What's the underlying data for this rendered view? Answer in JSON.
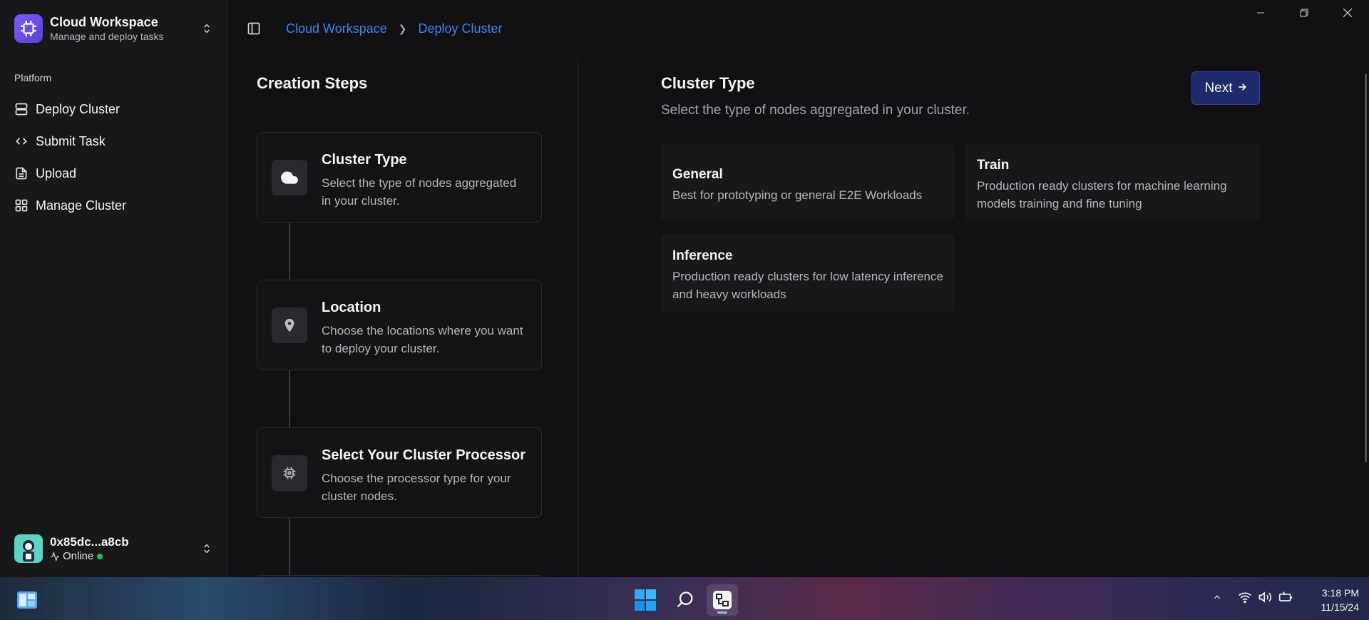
{
  "sidebar": {
    "brand_title": "Cloud Workspace",
    "brand_subtitle": "Manage and deploy tasks",
    "section_label": "Platform",
    "items": [
      {
        "label": "Deploy Cluster",
        "icon": "server-icon"
      },
      {
        "label": "Submit Task",
        "icon": "code-icon"
      },
      {
        "label": "Upload",
        "icon": "file-icon"
      },
      {
        "label": "Manage Cluster",
        "icon": "grid-icon"
      }
    ],
    "user": {
      "name": "0x85dc...a8cb",
      "status": "Online"
    }
  },
  "breadcrumb": {
    "root": "Cloud Workspace",
    "current": "Deploy Cluster"
  },
  "steps": {
    "title": "Creation Steps",
    "items": [
      {
        "title": "Cluster Type",
        "description": "Select the type of nodes aggregated in your cluster.",
        "icon": "cloud-icon"
      },
      {
        "title": "Location",
        "description": "Choose the locations where you want to deploy your cluster.",
        "icon": "map-pin-icon"
      },
      {
        "title": "Select Your Cluster Processor",
        "description": "Choose the processor type for your cluster nodes.",
        "icon": "cpu-icon"
      }
    ]
  },
  "cluster_type": {
    "title": "Cluster Type",
    "subtitle": "Select the type of nodes aggregated in your cluster.",
    "next_label": "Next",
    "options": [
      {
        "title": "General",
        "description": "Best for prototyping or general E2E Workloads"
      },
      {
        "title": "Train",
        "description": "Production ready clusters for machine learning models training and fine tuning"
      },
      {
        "title": "Inference",
        "description": "Production ready clusters for low latency inference and heavy workloads"
      }
    ]
  },
  "taskbar": {
    "time": "3:18 PM",
    "date": "11/15/24"
  },
  "colors": {
    "accent": "#3b82f6",
    "online": "#22c55e",
    "next_bg": "#1e2a6b"
  }
}
